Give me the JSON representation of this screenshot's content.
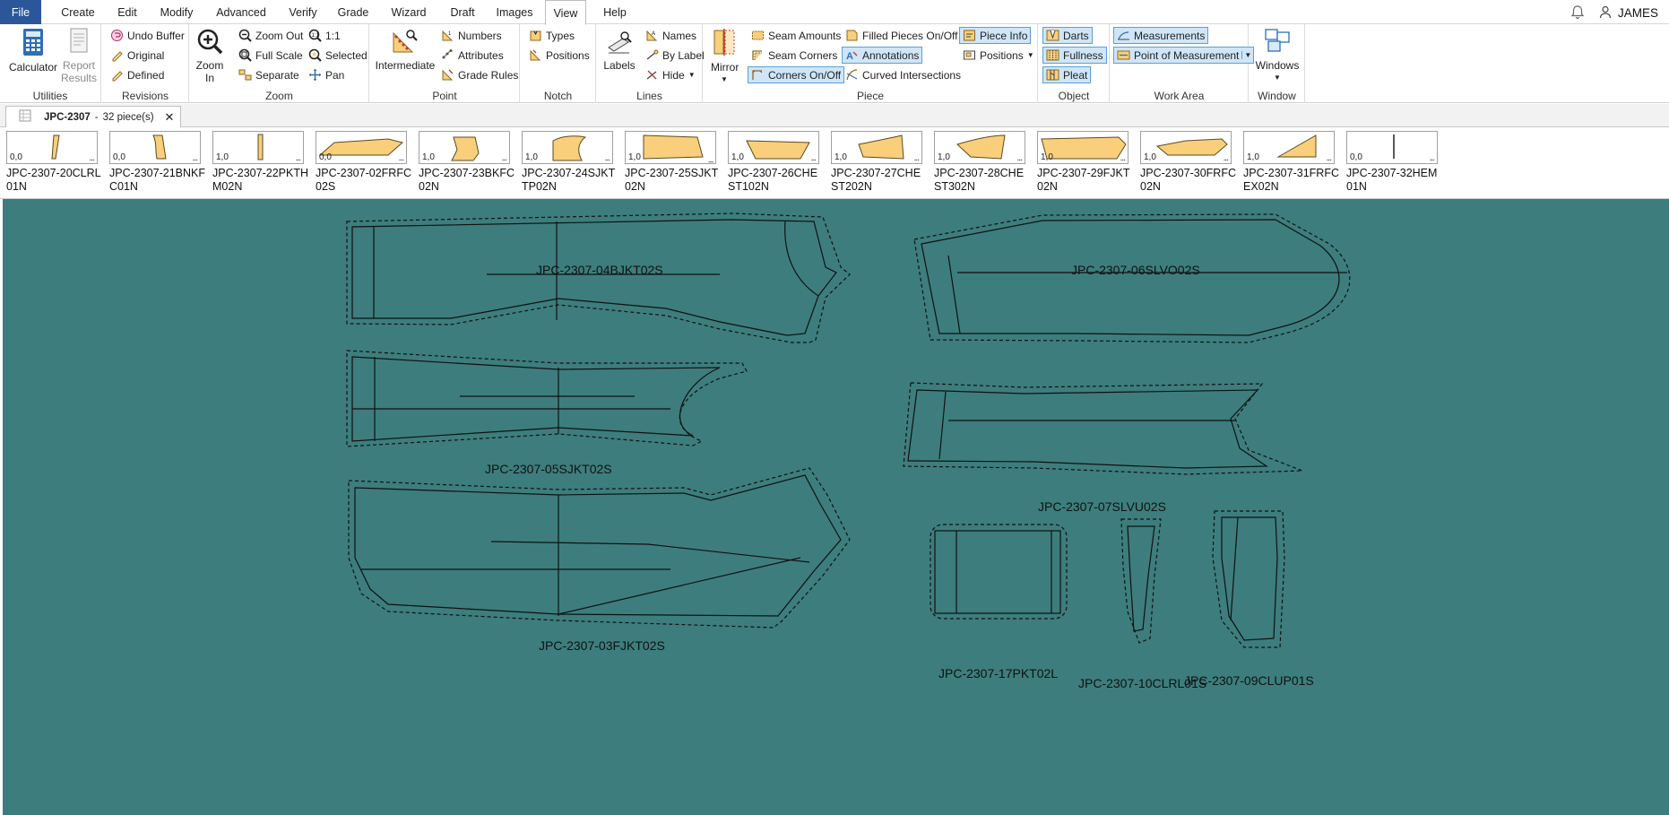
{
  "menu": {
    "items": [
      "File",
      "Create",
      "Edit",
      "Modify",
      "Advanced",
      "Verify",
      "Grade",
      "Wizard",
      "Draft",
      "Images",
      "View",
      "Help"
    ],
    "active": "View",
    "user": "JAMES"
  },
  "ribbon": {
    "utilities": {
      "label": "Utilities",
      "calculator": "Calculator",
      "report_l1": "Report",
      "report_l2": "Results"
    },
    "revisions": {
      "label": "Revisions",
      "undo_buffer": "Undo Buffer",
      "original": "Original",
      "defined": "Defined"
    },
    "zoom": {
      "label": "Zoom",
      "zoom_in_l1": "Zoom",
      "zoom_in_l2": "In",
      "zoom_out": "Zoom Out",
      "full_scale": "Full Scale",
      "separate": "Separate",
      "one_to_one": "1:1",
      "selected": "Selected",
      "pan": "Pan"
    },
    "point": {
      "label": "Point",
      "intermediate": "Intermediate",
      "numbers": "Numbers",
      "attributes": "Attributes",
      "grade_rules": "Grade Rules"
    },
    "notch": {
      "label": "Notch",
      "types": "Types",
      "positions": "Positions"
    },
    "lines": {
      "label": "Lines",
      "labels": "Labels",
      "names": "Names",
      "by_label": "By Label",
      "hide": "Hide"
    },
    "piece": {
      "label": "Piece",
      "mirror": "Mirror",
      "seam_amounts": "Seam Amounts",
      "seam_corners": "Seam Corners",
      "corners_on_off": "Corners On/Off",
      "filled_pieces": "Filled Pieces On/Off",
      "annotations": "Annotations",
      "curved_intersections": "Curved Intersections",
      "piece_info": "Piece Info",
      "positions": "Positions"
    },
    "object": {
      "label": "Object",
      "darts": "Darts",
      "fullness": "Fullness",
      "pleat": "Pleat"
    },
    "work_area": {
      "label": "Work Area",
      "measurements": "Measurements",
      "point_of_measurement": "Point of Measurement"
    },
    "window": {
      "label": "Window",
      "windows": "Windows"
    }
  },
  "doc_tab": {
    "title": "JPC-2307",
    "separator": "-",
    "count": "32 piece(s)"
  },
  "pieces_strip": [
    {
      "num": "0,0",
      "name": "JPC-2307-20CLRL01N",
      "dots": "..."
    },
    {
      "num": "0,0",
      "name": "JPC-2307-21BNKFC01N",
      "dots": "..."
    },
    {
      "num": "1,0",
      "name": "JPC-2307-22PKTHM02N",
      "dots": "..."
    },
    {
      "num": "0,0",
      "name": "JPC-2307-02FRFC02S",
      "dots": "..."
    },
    {
      "num": "1,0",
      "name": "JPC-2307-23BKFC02N",
      "dots": "..."
    },
    {
      "num": "1,0",
      "name": "JPC-2307-24SJKTTP02N",
      "dots": "..."
    },
    {
      "num": "1,0",
      "name": "JPC-2307-25SJKT02N",
      "dots": "_"
    },
    {
      "num": "1,0",
      "name": "JPC-2307-26CHEST102N",
      "dots": "..."
    },
    {
      "num": "1,0",
      "name": "JPC-2307-27CHEST202N",
      "dots": "..."
    },
    {
      "num": "1,0",
      "name": "JPC-2307-28CHEST302N",
      "dots": "..."
    },
    {
      "num": "1,0",
      "name": "JPC-2307-29FJKT02N",
      "dots": "..."
    },
    {
      "num": "1,0",
      "name": "JPC-2307-30FRFC02N",
      "dots": "..."
    },
    {
      "num": "1,0",
      "name": "JPC-2307-31FRFCEX02N",
      "dots": "..."
    },
    {
      "num": "0,0",
      "name": "JPC-2307-32HEM01N",
      "dots": "..."
    }
  ],
  "canvas_pieces": [
    "JPC-2307-04BJKT02S",
    "JPC-2307-06SLVO02S",
    "JPC-2307-05SJKT02S",
    "JPC-2307-07SLVU02S",
    "JPC-2307-03FJKT02S",
    "JPC-2307-17PKT02L",
    "JPC-2307-10CLRL01S",
    "JPC-2307-09CLUP01S"
  ],
  "colors": {
    "canvas": "#3d7d7d",
    "piece_fill": "#f9cf7c",
    "accent": "#2b579a",
    "toggle_on": "#cfe6f8"
  }
}
